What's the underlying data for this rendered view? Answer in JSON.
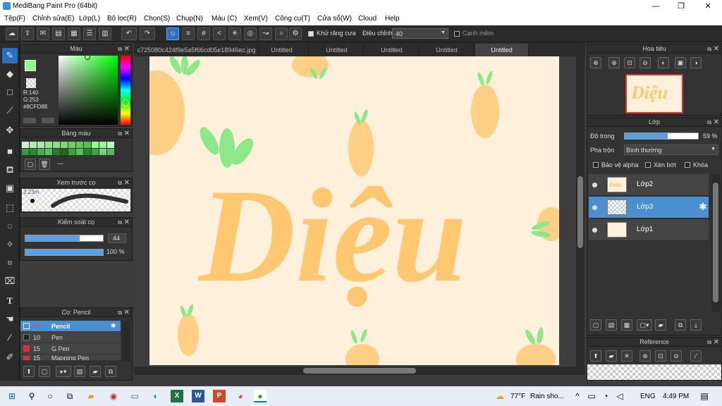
{
  "window": {
    "title": "MediBang Paint Pro (64bit)",
    "min": "—",
    "max": "❐",
    "close": "✕"
  },
  "menu": [
    "Tệp(F)",
    "Chỉnh sửa(E)",
    "Lớp(L)",
    "Bộ lọc(R)",
    "Chọn(S)",
    "Chụp(N)",
    "Màu (C)",
    "Xem(V)",
    "Công cụ(T)",
    "Cửa sổ(W)",
    "Cloud",
    "Help"
  ],
  "toolbar": {
    "antialias_label": "Khử răng cưa",
    "correction_label": "Điều chỉnh",
    "correction_value": "40",
    "soft_edge_label": "Cạnh mềm",
    "antialias_checked": true,
    "soft_edge_checked": false
  },
  "color_panel": {
    "title": "Màu",
    "r": "R:140",
    "g": "G:253",
    "b": "B:136",
    "hex": "#8CFD88",
    "current_color": "#8CFD88"
  },
  "palette_panel": {
    "title": "Bảng màu",
    "dash": "---"
  },
  "brush_preview_panel": {
    "title": "Xem trước cọ",
    "size": "3.23m"
  },
  "brush_control_panel": {
    "title": "Kiểm soát cọ",
    "size_value": "44",
    "opacity_value": "100 %",
    "size_fraction": 0.7,
    "opacity_fraction": 1.0
  },
  "brush_list_panel": {
    "title": "Cọ: Pencil",
    "brushes": [
      {
        "size": "44",
        "name": "Pencil",
        "color": "#333333",
        "selected": true
      },
      {
        "size": "10",
        "name": "Pen",
        "color": "#222222",
        "selected": false
      },
      {
        "size": "15",
        "name": "G Pen",
        "color": "#e03030",
        "selected": false
      },
      {
        "size": "15",
        "name": "Mapping Pen",
        "color": "#e03030",
        "selected": false
      }
    ]
  },
  "tabs": [
    "c725080c424f9e5a5f66cd05e18946ec.jpg",
    "Untitled",
    "Untitled",
    "Untitled",
    "Untitled",
    "Untitled"
  ],
  "artwork": {
    "text": "Diệu",
    "text_color": "#ffc870",
    "carrot_color": "#ffcf85",
    "leaf_color": "#8de88a"
  },
  "navigator_panel": {
    "title": "Hoa tiêu",
    "thumb_text": "Diệu"
  },
  "layer_panel": {
    "title": "Lớp",
    "opacity_label": "Độ trong",
    "opacity_value": "59 %",
    "opacity_fraction": 0.59,
    "blend_label": "Pha trộn",
    "blend_value": "Bình thường",
    "protect_alpha": "Bảo vệ alpha",
    "clipping": "Xén bớt",
    "lock": "Khóa",
    "layers": [
      {
        "name": "Lớp2",
        "selected": false
      },
      {
        "name": "Lớp3",
        "selected": true
      },
      {
        "name": "Lớp1",
        "selected": false
      }
    ]
  },
  "reference_panel": {
    "title": "Reference"
  },
  "taskbar": {
    "weather_temp": "77°F",
    "weather_text": "Rain sho...",
    "language": "ENG",
    "time": "4:49 PM"
  }
}
